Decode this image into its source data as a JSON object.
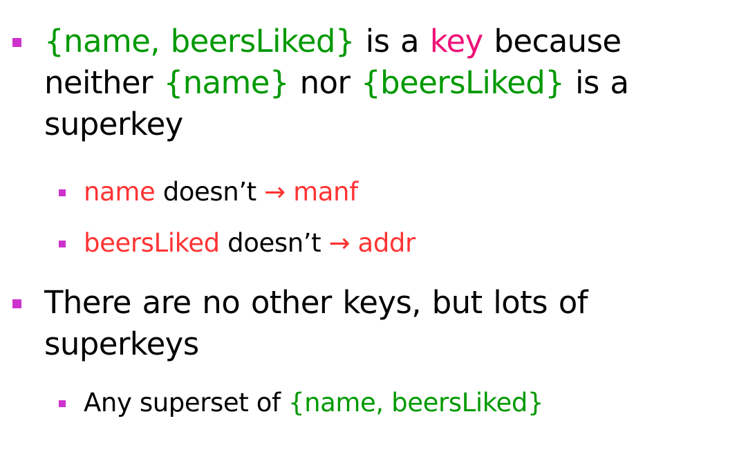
{
  "colors": {
    "bullet_marker": "#cc33cc",
    "attribute_set": "#009900",
    "keyword": "#ee1177",
    "fd_text": "#ff3333",
    "body_text": "#000000",
    "background": "#ffffff"
  },
  "bullets": [
    {
      "lead_set": "{name, beersLiked}",
      "text_1": " is a ",
      "keyword": "key",
      "text_2": " because neither ",
      "set_a": "{name}",
      "text_3": " nor ",
      "set_b": "{beersLiked}",
      "text_4": " is a superkey",
      "sub": [
        {
          "lhs": "name",
          "mid": " doesn’t ",
          "arrow": "→",
          "rhs": " manf"
        },
        {
          "lhs": "beersLiked",
          "mid": " doesn’t ",
          "arrow": "→",
          "rhs": " addr"
        }
      ]
    },
    {
      "text": "There are no other keys, but lots of superkeys",
      "sub": [
        {
          "text": "Any superset of ",
          "set": "{name, beersLiked}"
        }
      ]
    }
  ]
}
